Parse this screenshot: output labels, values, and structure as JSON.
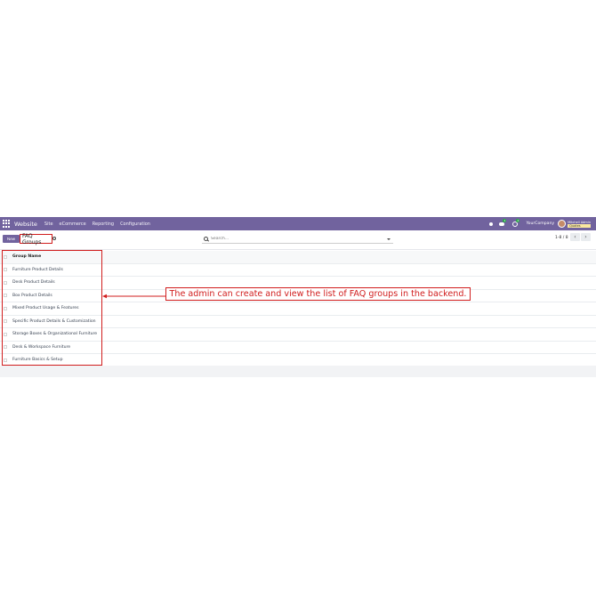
{
  "navbar": {
    "app_name": "Website",
    "menu": [
      "Site",
      "eCommerce",
      "Reporting",
      "Configuration"
    ],
    "chat_badge": "1",
    "activity_badge": "2",
    "company": "YourCompany",
    "user_name": "Mitchell Admin",
    "db_name": "Quotes",
    "background_color": "#71639e"
  },
  "control_panel": {
    "new_label": "New",
    "title": "FAQ Groups",
    "search_placeholder": "Search...",
    "pager": "1-8 / 8"
  },
  "table": {
    "column": "Group Name",
    "rows": [
      "Furniture Product Details",
      "Desk Product Details",
      "Box Product Details",
      "Mixed Product Usage & Features",
      "Specific Product Details & Customization",
      "Storage Boxes & Organizational Furniture",
      "Desk & Workspace Furniture",
      "Furniture Basics & Setup"
    ]
  },
  "annotation": {
    "text": "The admin can create and view the list of FAQ groups in the backend.",
    "color": "#d11e1e"
  }
}
